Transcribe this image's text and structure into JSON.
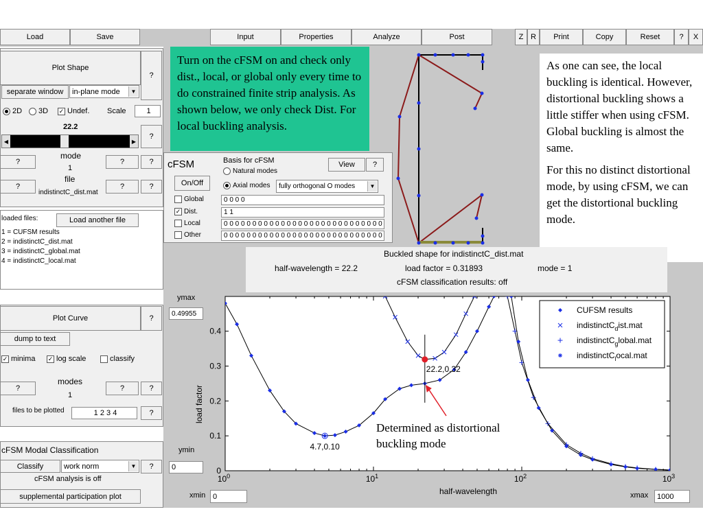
{
  "toolbar": {
    "load": "Load",
    "save": "Save",
    "input": "Input",
    "properties": "Properties",
    "analyze": "Analyze",
    "post": "Post",
    "z": "Z",
    "r": "R",
    "print": "Print",
    "copy": "Copy",
    "reset": "Reset",
    "help": "?",
    "close": "X"
  },
  "shape_panel": {
    "plot_shape": "Plot Shape",
    "help": "?",
    "separate_window": "separate window",
    "mode_select": "in-plane mode",
    "radio_2d": "2D",
    "radio_3d": "3D",
    "undef": "Undef.",
    "scale_label": "Scale",
    "scale_value": "1",
    "slider_value": "22.2",
    "mode_label": "mode",
    "mode_value": "1",
    "file_label": "file",
    "file_value": "indistinctC_dist.mat",
    "q": "?"
  },
  "loaded_files": {
    "label": "loaded files:",
    "load_another": "Load another file",
    "items": [
      "1 = CUFSM results",
      "2 = indistinctC_dist.mat",
      "3 = indistinctC_global.mat",
      "4 = indistinctC_local.mat"
    ]
  },
  "curve_panel": {
    "plot_curve": "Plot Curve",
    "help": "?",
    "dump": "dump to text",
    "minima": "minima",
    "log_scale": "log scale",
    "classify": "classify",
    "modes_label": "modes",
    "modes_value": "1",
    "files_label": "files to be plotted",
    "files_value": "1 2 3 4",
    "q": "?"
  },
  "classification_panel": {
    "title": "cFSM Modal Classification",
    "classify_btn": "Classify",
    "norm": "work norm",
    "help": "?",
    "status": "cFSM analysis is off",
    "supplemental": "supplemental participation plot"
  },
  "cfsm_panel": {
    "title": "cFSM",
    "basis_label": "Basis for cFSM",
    "natural": "Natural modes",
    "view": "View",
    "help": "?",
    "onoff": "On/Off",
    "axial": "Axial modes",
    "basis_select": "fully orthogonal O modes",
    "global_label": "Global",
    "global_value": "0 0 0 0",
    "dist_label": "Dist.",
    "dist_value": "1 1",
    "local_label": "Local",
    "local_value": "0 0 0 0 0 0 0 0 0 0 0 0 0 0 0 0 0 0 0 0 0 0 0 0 0 0 0 0 0 0",
    "other_label": "Other",
    "other_value": "0 0 0 0 0 0 0 0 0 0 0 0 0 0 0 0 0 0 0 0 0 0 0 0 0 0 0 0 0 0"
  },
  "info_bar": {
    "title": "Buckled shape for indistinctC_dist.mat",
    "half_wavelength": "half-wavelength = 22.2",
    "load_factor": "load factor = 0.31893",
    "mode": "mode = 1",
    "classification": "cFSM classification results: off"
  },
  "axis_controls": {
    "ymax_label": "ymax",
    "ymax_value": "0.49955",
    "ymin_label": "ymin",
    "ymin_value": "0",
    "xmin_label": "xmin",
    "xmin_value": "0",
    "xmax_label": "xmax",
    "xmax_value": "1000"
  },
  "annotations": {
    "green_note": "Turn on the cFSM on and check only dist., local, or global only every time to do constrained finite strip analysis. As shown below, we only check Dist. For local buckling analysis.",
    "right_note_1": "As one can see, the local buckling is identical. However, distortional buckling shows a little stiffer when using cFSM. Global buckling is almost the same.",
    "right_note_2": "For this no distinct distortional mode, by using cFSM, we can get the distortional buckling mode.",
    "arrow_note": "Determined as distortional buckling mode",
    "green_color": "#1fc492"
  },
  "chart_data": {
    "type": "line",
    "xlabel": "half-wavelength",
    "ylabel": "load factor",
    "xscale": "log",
    "xlim": [
      1,
      1000
    ],
    "ylim": [
      0,
      0.49955
    ],
    "xticks": [
      1,
      10,
      100,
      1000
    ],
    "yticks": [
      0,
      0.1,
      0.2,
      0.3,
      0.4
    ],
    "legend_position": "top-right",
    "legend": [
      {
        "marker": "diamond",
        "text": "CUFSM results"
      },
      {
        "marker": "x",
        "text": "indistinctC_dist.mat",
        "base": "indistinctC",
        "sub": "d",
        "rest": "ist.mat"
      },
      {
        "marker": "plus",
        "text": "indistinctC_global.mat",
        "base": "indistinctC",
        "sub": "g",
        "rest": "lobal.mat"
      },
      {
        "marker": "star",
        "text": "indistinctC_local.mat",
        "base": "indistinctC",
        "sub": "l",
        "rest": "ocal.mat"
      }
    ],
    "series": [
      {
        "marker": "diamond",
        "x": [
          1,
          1.2,
          1.5,
          2,
          2.5,
          3,
          4,
          4.7,
          5.5,
          6.5,
          8,
          10,
          12,
          15,
          18,
          22.2,
          28,
          35,
          42,
          50,
          60,
          65
        ],
        "y": [
          0.48,
          0.42,
          0.33,
          0.23,
          0.17,
          0.135,
          0.108,
          0.1,
          0.102,
          0.112,
          0.13,
          0.165,
          0.205,
          0.235,
          0.245,
          0.25,
          0.26,
          0.29,
          0.34,
          0.4,
          0.47,
          0.5
        ]
      },
      {
        "marker": "x",
        "x": [
          12,
          14,
          17,
          20,
          22.2,
          26,
          30,
          36,
          42,
          48
        ],
        "y": [
          0.5,
          0.44,
          0.37,
          0.33,
          0.319,
          0.322,
          0.34,
          0.39,
          0.45,
          0.5
        ]
      },
      {
        "marker": "plus",
        "x": [
          80,
          90,
          100,
          120,
          150,
          200,
          250,
          300,
          400,
          500,
          600,
          800,
          1000
        ],
        "y": [
          0.5,
          0.4,
          0.31,
          0.21,
          0.135,
          0.075,
          0.05,
          0.035,
          0.02,
          0.012,
          0.008,
          0.004,
          0.002
        ]
      },
      {
        "marker": "diamond",
        "x": [
          85,
          95,
          110,
          130,
          160,
          200,
          250,
          300,
          400,
          500,
          600,
          800,
          1000
        ],
        "y": [
          0.5,
          0.37,
          0.26,
          0.18,
          0.115,
          0.07,
          0.045,
          0.032,
          0.018,
          0.011,
          0.007,
          0.004,
          0.002
        ]
      }
    ],
    "marker_label_min": "4.7,0.10",
    "marker_label_selected": "22.2,0.32",
    "selected_point": [
      22.2,
      0.319
    ],
    "minimum_point": [
      4.7,
      0.1
    ]
  }
}
